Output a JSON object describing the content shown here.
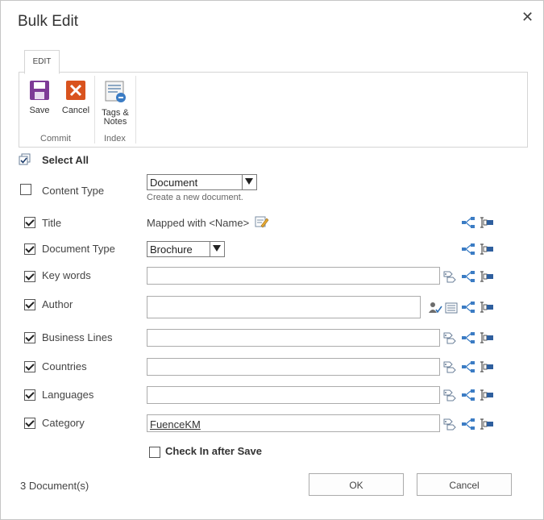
{
  "dialog": {
    "title": "Bulk Edit",
    "close_symbol": "✕"
  },
  "ribbon": {
    "tab": "EDIT",
    "save_label": "Save",
    "cancel_label": "Cancel",
    "tags_label_line1": "Tags &",
    "tags_label_line2": "Notes",
    "group_commit": "Commit",
    "group_index": "Index"
  },
  "select_all": "Select All",
  "content_type": {
    "label": "Content Type",
    "value": "Document",
    "hint": "Create a new document."
  },
  "fields": {
    "title": {
      "label": "Title",
      "value": "Mapped with <Name>"
    },
    "doc_type": {
      "label": "Document Type",
      "value": "Brochure"
    },
    "keywords": {
      "label": "Key words",
      "value": ""
    },
    "author": {
      "label": "Author",
      "value": ""
    },
    "business_lines": {
      "label": "Business Lines",
      "value": ""
    },
    "countries": {
      "label": "Countries",
      "value": ""
    },
    "languages": {
      "label": "Languages",
      "value": ""
    },
    "category": {
      "label": "Category",
      "value": "FuenceKM"
    }
  },
  "check_in": "Check In after Save",
  "doc_count": "3  Document(s)",
  "ok_label": "OK",
  "cancel_label": "Cancel"
}
